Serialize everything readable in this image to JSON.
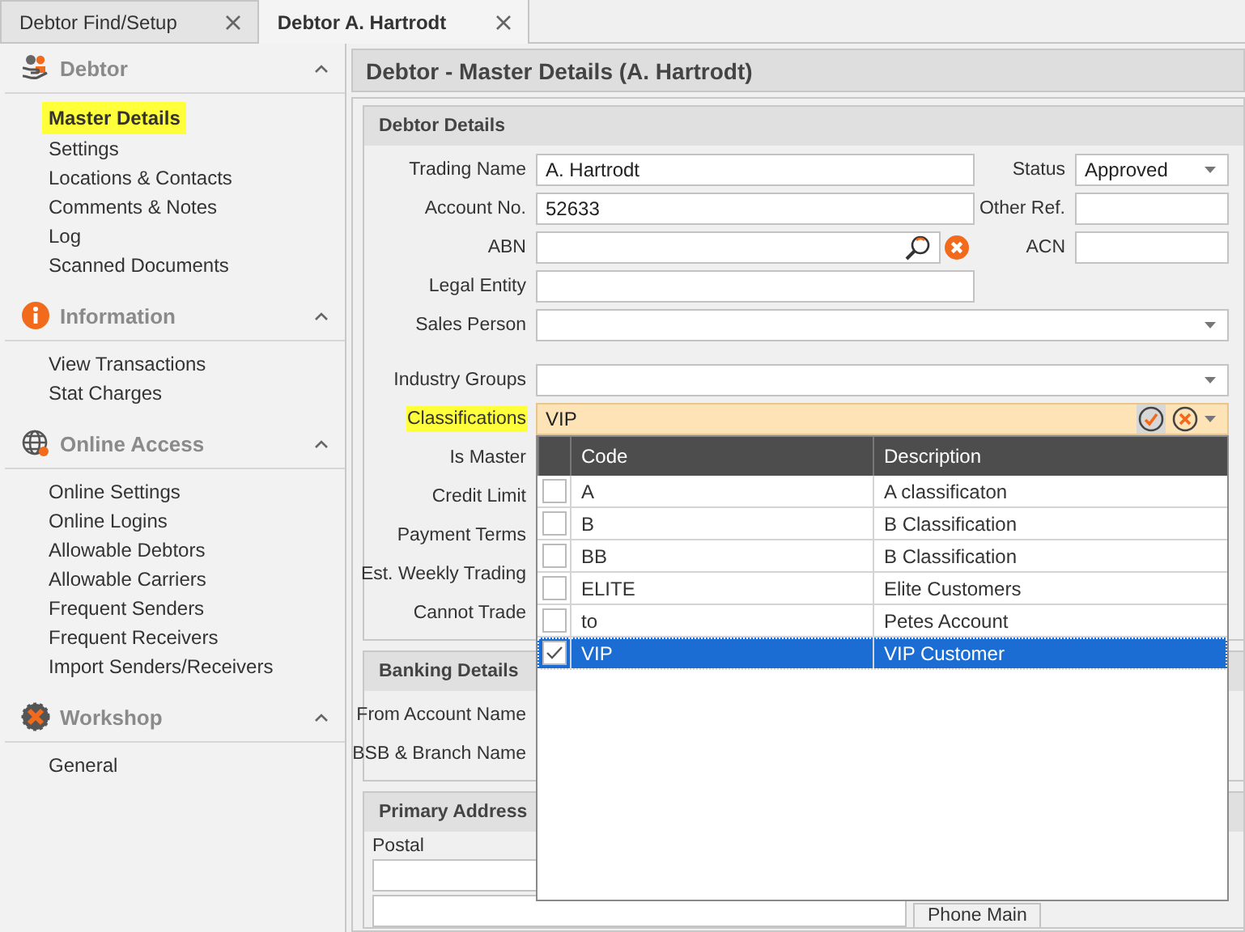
{
  "tabs": [
    {
      "label": "Debtor Find/Setup",
      "selected": false
    },
    {
      "label": "Debtor A. Hartrodt",
      "selected": true
    }
  ],
  "sidebar": {
    "groups": [
      {
        "title": "Debtor",
        "kind": "debtor",
        "expanded": true,
        "items": [
          {
            "label": "Master Details",
            "selected": true
          },
          {
            "label": "Settings",
            "selected": false
          },
          {
            "label": "Locations & Contacts",
            "selected": false
          },
          {
            "label": "Comments & Notes",
            "selected": false
          },
          {
            "label": "Log",
            "selected": false
          },
          {
            "label": "Scanned Documents",
            "selected": false
          }
        ]
      },
      {
        "title": "Information",
        "kind": "info",
        "expanded": true,
        "items": [
          {
            "label": "View Transactions",
            "selected": false
          },
          {
            "label": "Stat Charges",
            "selected": false
          }
        ]
      },
      {
        "title": "Online Access",
        "kind": "globe",
        "expanded": true,
        "items": [
          {
            "label": "Online Settings",
            "selected": false
          },
          {
            "label": "Online Logins",
            "selected": false
          },
          {
            "label": "Allowable Debtors",
            "selected": false
          },
          {
            "label": "Allowable Carriers",
            "selected": false
          },
          {
            "label": "Frequent Senders",
            "selected": false
          },
          {
            "label": "Frequent Receivers",
            "selected": false
          },
          {
            "label": "Import Senders/Receivers",
            "selected": false
          }
        ]
      },
      {
        "title": "Workshop",
        "kind": "workshop",
        "expanded": true,
        "items": [
          {
            "label": "General",
            "selected": false
          }
        ]
      }
    ]
  },
  "main": {
    "title": "Debtor - Master Details (A. Hartrodt)",
    "debtor_details": {
      "title": "Debtor Details",
      "rows": [
        {
          "kind": "field",
          "label": "Trading Name",
          "highlighted": false,
          "field": {
            "kind": "text",
            "value": "A. Hartrodt"
          },
          "side": {
            "label": "Status",
            "field": {
              "kind": "dropdown",
              "value": "Approved"
            }
          }
        },
        {
          "kind": "field",
          "label": "Account No.",
          "highlighted": false,
          "field": {
            "kind": "text",
            "value": "52633"
          },
          "side": {
            "label": "Other Ref.",
            "field": {
              "kind": "text"
            }
          }
        },
        {
          "kind": "field",
          "label": "ABN",
          "highlighted": false,
          "field": {
            "kind": "lookup"
          },
          "side": {
            "label": "ACN",
            "field": {
              "kind": "text"
            }
          }
        },
        {
          "kind": "field",
          "label": "Legal Entity",
          "highlighted": false,
          "field": {
            "kind": "text"
          }
        },
        {
          "kind": "field",
          "label": "Sales Person",
          "highlighted": false,
          "field": {
            "kind": "dropdown"
          }
        },
        {
          "kind": "blank"
        },
        {
          "kind": "field",
          "label": "Industry Groups",
          "highlighted": false,
          "field": {
            "kind": "dropdown"
          }
        },
        {
          "kind": "field",
          "label": "Classifications",
          "highlighted": true,
          "field": {
            "kind": "checklist",
            "value": "VIP",
            "open": true,
            "columns": [
              "Code",
              "Description"
            ],
            "items": [
              {
                "code": "A",
                "description": "A classificaton",
                "checked": false,
                "selected": false
              },
              {
                "code": "B",
                "description": "B Classification",
                "checked": false,
                "selected": false
              },
              {
                "code": "BB",
                "description": "B Classification",
                "checked": false,
                "selected": false
              },
              {
                "code": "ELITE",
                "description": "Elite Customers",
                "checked": false,
                "selected": false
              },
              {
                "code": "to",
                "description": "Petes Account",
                "checked": false,
                "selected": false
              },
              {
                "code": "VIP",
                "description": "VIP Customer",
                "checked": true,
                "selected": true
              }
            ]
          }
        },
        {
          "kind": "field",
          "label": "Is Master",
          "highlighted": false
        },
        {
          "kind": "field",
          "label": "Credit Limit",
          "highlighted": false
        },
        {
          "kind": "field",
          "label": "Payment Terms",
          "highlighted": false
        },
        {
          "kind": "field",
          "label": "Est. Weekly Trading",
          "highlighted": false
        },
        {
          "kind": "field",
          "label": "Cannot Trade",
          "highlighted": false
        }
      ]
    },
    "banking_details": {
      "title": "Banking Details",
      "rows": [
        {
          "kind": "field",
          "label": "From Account Name",
          "highlighted": false
        },
        {
          "kind": "field",
          "label": "BSB & Branch Name",
          "highlighted": false
        }
      ]
    },
    "primary_addresses": {
      "title": "Primary Address",
      "postal_label": "Postal",
      "phone_label": "Phone Main"
    }
  }
}
